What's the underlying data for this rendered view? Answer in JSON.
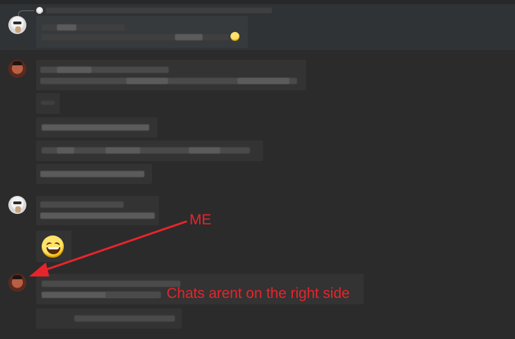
{
  "annotations": {
    "me_label": "ME",
    "note_label": "Chats arent on the right side",
    "color": "#e8242b"
  },
  "icons": {
    "emoji_large": "grinning-squinting-face",
    "emoji_inline": "smiling-face-icon"
  },
  "colors": {
    "background": "#2b2b2b",
    "bubble": "#333333",
    "highlight_row": "#2f3336"
  }
}
